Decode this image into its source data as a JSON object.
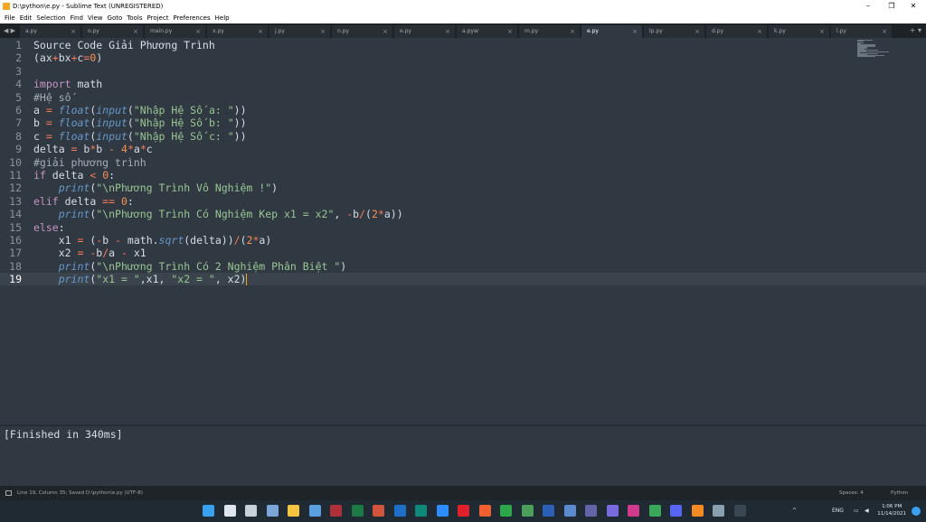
{
  "window": {
    "title": "D:\\python\\e.py - Sublime Text (UNREGISTERED)",
    "minimize_glyph": "–",
    "maximize_glyph": "❐",
    "close_glyph": "✕"
  },
  "menu": [
    "File",
    "Edit",
    "Selection",
    "Find",
    "View",
    "Goto",
    "Tools",
    "Project",
    "Preferences",
    "Help"
  ],
  "tabs": [
    {
      "label": "a.py",
      "active": false
    },
    {
      "label": "o.py",
      "active": false
    },
    {
      "label": "main.py",
      "active": false
    },
    {
      "label": "x.py",
      "active": false
    },
    {
      "label": "j.py",
      "active": false
    },
    {
      "label": "n.py",
      "active": false
    },
    {
      "label": "e.py",
      "active": false
    },
    {
      "label": "a.pyw",
      "active": false
    },
    {
      "label": "m.py",
      "active": false
    },
    {
      "label": "e.py",
      "active": true
    },
    {
      "label": "lp.py",
      "active": false
    },
    {
      "label": "d.py",
      "active": false
    },
    {
      "label": "k.py",
      "active": false
    },
    {
      "label": "l.py",
      "active": false
    }
  ],
  "tab_nav": "◀ ▶",
  "tab_plus": "+ ▾",
  "tab_close_glyph": "×",
  "editor": {
    "current_line": 19,
    "lines": [
      [
        {
          "t": "Source Code Giải Phương Trình",
          "c": ""
        }
      ],
      [
        {
          "t": "(ax",
          "c": ""
        },
        {
          "t": "+",
          "c": "op"
        },
        {
          "t": "bx",
          "c": ""
        },
        {
          "t": "+",
          "c": "op"
        },
        {
          "t": "c",
          "c": ""
        },
        {
          "t": "=",
          "c": "op"
        },
        {
          "t": "0",
          "c": "num"
        },
        {
          "t": ")",
          "c": ""
        }
      ],
      [],
      [
        {
          "t": "import",
          "c": "kw"
        },
        {
          "t": " math",
          "c": ""
        }
      ],
      [
        {
          "t": "#Hệ số",
          "c": "cm"
        }
      ],
      [
        {
          "t": "a ",
          "c": ""
        },
        {
          "t": "=",
          "c": "op"
        },
        {
          "t": " ",
          "c": ""
        },
        {
          "t": "float",
          "c": "fn"
        },
        {
          "t": "(",
          "c": ""
        },
        {
          "t": "input",
          "c": "fn"
        },
        {
          "t": "(",
          "c": ""
        },
        {
          "t": "\"Nhập Hệ Số a: \"",
          "c": "str"
        },
        {
          "t": "))",
          "c": ""
        }
      ],
      [
        {
          "t": "b ",
          "c": ""
        },
        {
          "t": "=",
          "c": "op"
        },
        {
          "t": " ",
          "c": ""
        },
        {
          "t": "float",
          "c": "fn"
        },
        {
          "t": "(",
          "c": ""
        },
        {
          "t": "input",
          "c": "fn"
        },
        {
          "t": "(",
          "c": ""
        },
        {
          "t": "\"Nhập Hệ Số b: \"",
          "c": "str"
        },
        {
          "t": "))",
          "c": ""
        }
      ],
      [
        {
          "t": "c ",
          "c": ""
        },
        {
          "t": "=",
          "c": "op"
        },
        {
          "t": " ",
          "c": ""
        },
        {
          "t": "float",
          "c": "fn"
        },
        {
          "t": "(",
          "c": ""
        },
        {
          "t": "input",
          "c": "fn"
        },
        {
          "t": "(",
          "c": ""
        },
        {
          "t": "\"Nhập Hệ Số c: \"",
          "c": "str"
        },
        {
          "t": "))",
          "c": ""
        }
      ],
      [
        {
          "t": "delta ",
          "c": ""
        },
        {
          "t": "=",
          "c": "op"
        },
        {
          "t": " b",
          "c": ""
        },
        {
          "t": "*",
          "c": "op"
        },
        {
          "t": "b ",
          "c": ""
        },
        {
          "t": "-",
          "c": "op"
        },
        {
          "t": " ",
          "c": ""
        },
        {
          "t": "4",
          "c": "num"
        },
        {
          "t": "*",
          "c": "op"
        },
        {
          "t": "a",
          "c": ""
        },
        {
          "t": "*",
          "c": "op"
        },
        {
          "t": "c",
          "c": ""
        }
      ],
      [
        {
          "t": "#giải phương trình",
          "c": "cm"
        }
      ],
      [
        {
          "t": "if",
          "c": "kw"
        },
        {
          "t": " delta ",
          "c": ""
        },
        {
          "t": "<",
          "c": "op"
        },
        {
          "t": " ",
          "c": ""
        },
        {
          "t": "0",
          "c": "num"
        },
        {
          "t": ":",
          "c": ""
        }
      ],
      [
        {
          "t": "    ",
          "c": ""
        },
        {
          "t": "print",
          "c": "fn"
        },
        {
          "t": "(",
          "c": ""
        },
        {
          "t": "\"\\nPhương Trình Vô Nghiệm !\"",
          "c": "str"
        },
        {
          "t": ")",
          "c": ""
        }
      ],
      [
        {
          "t": "elif",
          "c": "kw"
        },
        {
          "t": " delta ",
          "c": ""
        },
        {
          "t": "==",
          "c": "op"
        },
        {
          "t": " ",
          "c": ""
        },
        {
          "t": "0",
          "c": "num"
        },
        {
          "t": ":",
          "c": ""
        }
      ],
      [
        {
          "t": "    ",
          "c": ""
        },
        {
          "t": "print",
          "c": "fn"
        },
        {
          "t": "(",
          "c": ""
        },
        {
          "t": "\"\\nPhương Trình Có Nghiệm Kep x1 = x2\"",
          "c": "str"
        },
        {
          "t": ", ",
          "c": ""
        },
        {
          "t": "-",
          "c": "op"
        },
        {
          "t": "b",
          "c": ""
        },
        {
          "t": "/",
          "c": "op"
        },
        {
          "t": "(",
          "c": ""
        },
        {
          "t": "2",
          "c": "num"
        },
        {
          "t": "*",
          "c": "op"
        },
        {
          "t": "a))",
          "c": ""
        }
      ],
      [
        {
          "t": "else",
          "c": "kw"
        },
        {
          "t": ":",
          "c": ""
        }
      ],
      [
        {
          "t": "    x1 ",
          "c": ""
        },
        {
          "t": "=",
          "c": "op"
        },
        {
          "t": " (",
          "c": ""
        },
        {
          "t": "-",
          "c": "op"
        },
        {
          "t": "b ",
          "c": ""
        },
        {
          "t": "-",
          "c": "op"
        },
        {
          "t": " math.",
          "c": ""
        },
        {
          "t": "sqrt",
          "c": "fn"
        },
        {
          "t": "(delta))",
          "c": ""
        },
        {
          "t": "/",
          "c": "op"
        },
        {
          "t": "(",
          "c": ""
        },
        {
          "t": "2",
          "c": "num"
        },
        {
          "t": "*",
          "c": "op"
        },
        {
          "t": "a)",
          "c": ""
        }
      ],
      [
        {
          "t": "    x2 ",
          "c": ""
        },
        {
          "t": "=",
          "c": "op"
        },
        {
          "t": " ",
          "c": ""
        },
        {
          "t": "-",
          "c": "op"
        },
        {
          "t": "b",
          "c": ""
        },
        {
          "t": "/",
          "c": "op"
        },
        {
          "t": "a ",
          "c": ""
        },
        {
          "t": "-",
          "c": "op"
        },
        {
          "t": " x1",
          "c": ""
        }
      ],
      [
        {
          "t": "    ",
          "c": ""
        },
        {
          "t": "print",
          "c": "fn"
        },
        {
          "t": "(",
          "c": ""
        },
        {
          "t": "\"\\nPhương Trình Có 2 Nghiệm Phân Biệt \"",
          "c": "str"
        },
        {
          "t": ")",
          "c": ""
        }
      ],
      [
        {
          "t": "    ",
          "c": ""
        },
        {
          "t": "print",
          "c": "fn"
        },
        {
          "t": "(",
          "c": ""
        },
        {
          "t": "\"x1 = \"",
          "c": "str"
        },
        {
          "t": ",x1, ",
          "c": ""
        },
        {
          "t": "\"x2 = \"",
          "c": "str"
        },
        {
          "t": ", x2)",
          "c": ""
        }
      ]
    ]
  },
  "output": {
    "text": "[Finished in 340ms]"
  },
  "status": {
    "left": "Line 19, Column 35; Saved D:\\python\\e.py (UTF-8)",
    "spaces": "Spaces: 4",
    "syntax": "Python"
  },
  "taskbar": {
    "tray_lang": "ENG",
    "tray_chevron": "^",
    "time": "1:06 PM",
    "date": "11/14/2021",
    "apps": [
      {
        "name": "windows-start-icon",
        "color": "#3aa0f0"
      },
      {
        "name": "search-icon",
        "color": "#e0e6ea"
      },
      {
        "name": "task-view-icon",
        "color": "#c8d0d8"
      },
      {
        "name": "widgets-icon",
        "color": "#7aa7d8"
      },
      {
        "name": "file-explorer-icon",
        "color": "#f5c542"
      },
      {
        "name": "store-icon",
        "color": "#5aa0e0"
      },
      {
        "name": "access-icon",
        "color": "#b0303a"
      },
      {
        "name": "excel-icon",
        "color": "#1e7a44"
      },
      {
        "name": "powerpoint-icon",
        "color": "#d0553a"
      },
      {
        "name": "outlook-icon",
        "color": "#1f6fc8"
      },
      {
        "name": "publisher-icon",
        "color": "#0f8a7a"
      },
      {
        "name": "zoom-icon",
        "color": "#2d8cff"
      },
      {
        "name": "opera-icon",
        "color": "#e0202a"
      },
      {
        "name": "brave-icon",
        "color": "#f06030"
      },
      {
        "name": "chrome-icon",
        "color": "#2ba84a"
      },
      {
        "name": "chrome-alt-icon",
        "color": "#4aa05a"
      },
      {
        "name": "word-icon",
        "color": "#2b5fb8"
      },
      {
        "name": "mail-icon",
        "color": "#5a8ad0"
      },
      {
        "name": "teams-icon",
        "color": "#6264a7"
      },
      {
        "name": "messenger-icon",
        "color": "#7a6ae0"
      },
      {
        "name": "instagram-icon",
        "color": "#d03a8a"
      },
      {
        "name": "camtasia-icon",
        "color": "#3aa85a"
      },
      {
        "name": "discord-icon",
        "color": "#5865f2"
      },
      {
        "name": "sublime-icon",
        "color": "#f58a23"
      },
      {
        "name": "explorer-window-icon",
        "color": "#8aa0b0"
      },
      {
        "name": "terminal-icon",
        "color": "#3a4650"
      }
    ]
  }
}
